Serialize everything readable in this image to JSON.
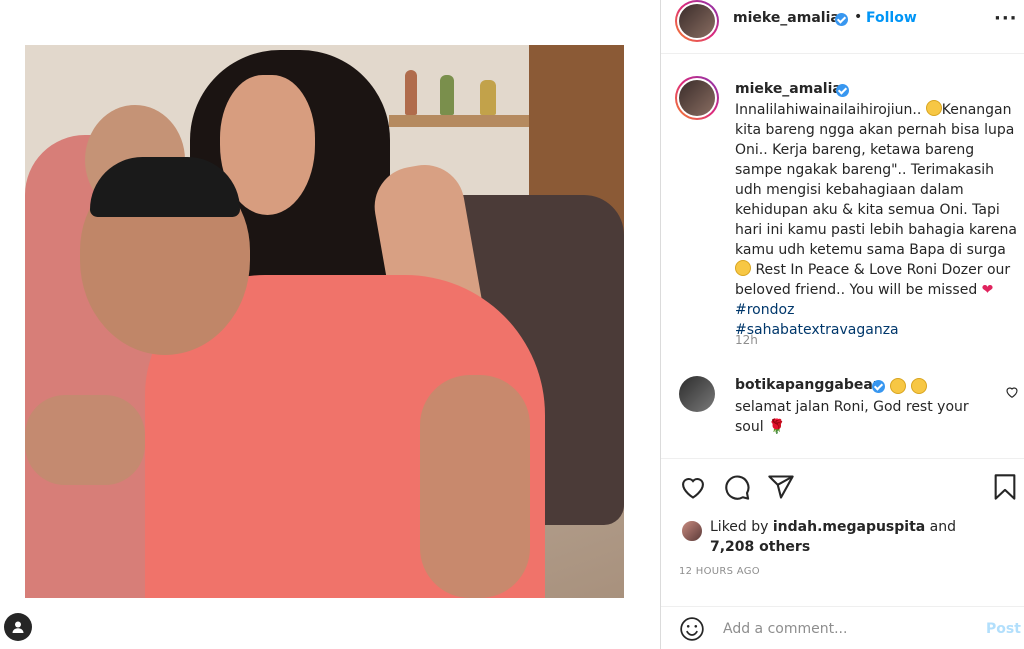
{
  "post": {
    "username": "mieke_amalia",
    "dot": "•",
    "follow_label": "Follow",
    "more_label": "···"
  },
  "caption": {
    "username": "mieke_amalia",
    "text_part1": "Innalilahiwainailaihirojiun.. ",
    "text_part2": "Kenangan kita bareng ngga akan pernah bisa lupa Oni.. Kerja bareng, ketawa bareng sampe ngakak bareng\".. Terimakasih udh mengisi kebahagiaan dalam kehidupan aku & kita semua Oni. Tapi hari ini kamu pasti lebih bahagia karena kamu udh ketemu sama Bapa di surga ",
    "text_part3": " Rest In Peace & Love Roni Dozer our beloved friend.. You will be missed ",
    "hashtag1": "#rondoz",
    "hashtag2": "#sahabatextravaganza",
    "time": "12h"
  },
  "comment2": {
    "username": "botikapanggabean",
    "text": "selamat jalan Roni, God rest your soul "
  },
  "likes": {
    "prefix": "Liked by ",
    "liker": "indah.megapuspita",
    "and": " and",
    "others": "7,208 others"
  },
  "timestamp": "12 HOURS AGO",
  "add_comment": {
    "placeholder": "Add a comment...",
    "post_label": "Post"
  },
  "icons": {
    "verified": "verified-badge-icon",
    "like": "heart-icon",
    "comment": "comment-icon",
    "share": "share-icon",
    "save": "bookmark-icon",
    "emoji": "smile-icon",
    "profile": "profile-icon"
  },
  "colors": {
    "accent": "#0095f6",
    "verified": "#3897f0",
    "hashtag": "#00376b",
    "muted": "#8e8e8e",
    "post_disabled": "#b2dffc"
  }
}
